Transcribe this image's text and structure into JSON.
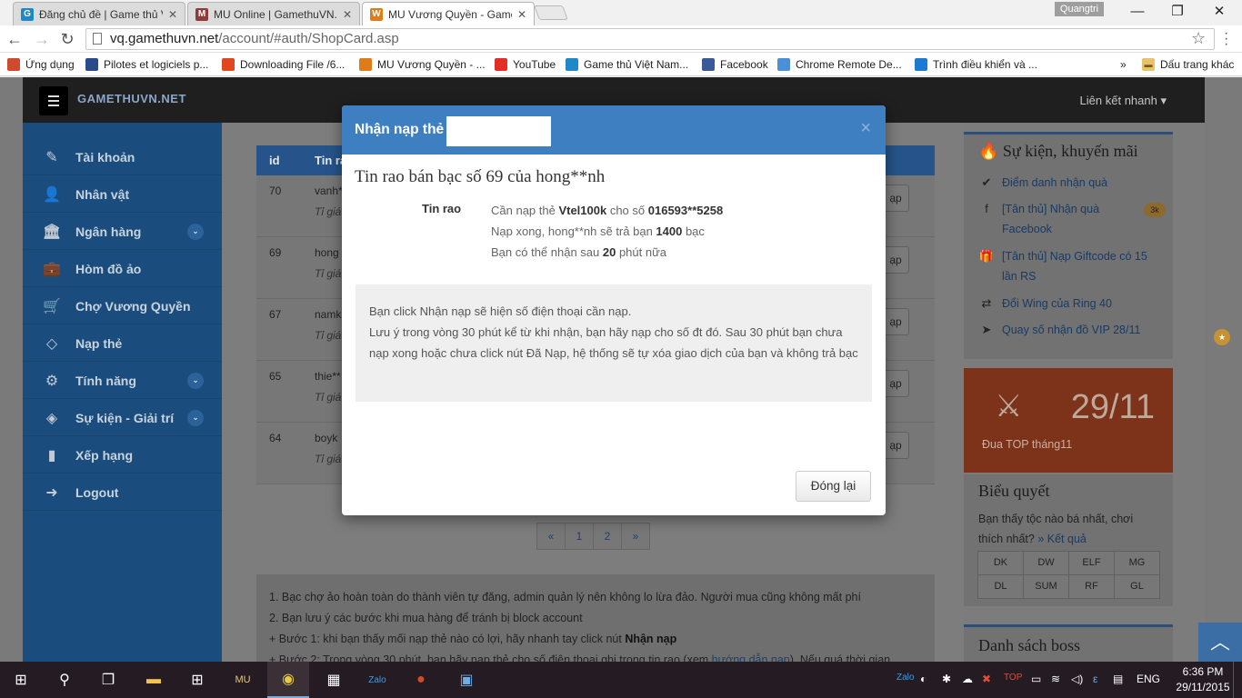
{
  "browser": {
    "tabs": [
      {
        "title": "Đăng chủ đề | Game thủ V",
        "icon": "G",
        "color": "#1e88c9",
        "active": false
      },
      {
        "title": "MU Online | GamethuVN.n",
        "icon": "M",
        "color": "#8f3b3b",
        "active": false
      },
      {
        "title": "MU Vương Quyền - Game",
        "icon": "W",
        "color": "#e07b1a",
        "active": true
      }
    ],
    "user": "Quangtri",
    "window_controls": [
      "—",
      "❐",
      "✕"
    ],
    "url_host": "vq.gamethuvn.net",
    "url_path": "/account/#auth/ShopCard.asp",
    "bookmarks": [
      {
        "label": "Ứng dụng",
        "icon": "apps-icon",
        "color": "#d04a2f"
      },
      {
        "label": "Pilotes et logiciels p...",
        "icon": "hp-icon",
        "color": "#2a4a8a"
      },
      {
        "label": "Downloading File /6...",
        "icon": "ball-icon",
        "color": "#e0461f"
      },
      {
        "label": "MU Vương Quyền - ...",
        "icon": "mu-icon",
        "color": "#e07b1a"
      },
      {
        "label": "YouTube",
        "icon": "youtube-icon",
        "color": "#e52d27"
      },
      {
        "label": "Game thủ Việt Nam...",
        "icon": "gamethu-icon",
        "color": "#1e88c9"
      },
      {
        "label": "Facebook",
        "icon": "facebook-icon",
        "color": "#3b5998"
      },
      {
        "label": "Chrome Remote De...",
        "icon": "remote-icon",
        "color": "#4a8fd8"
      },
      {
        "label": "Trình điều khiển và ...",
        "icon": "hp2-icon",
        "color": "#1a7bd0"
      }
    ],
    "overflow": "»",
    "other_bookmarks": "Dấu trang khác"
  },
  "site": {
    "logo": "GAMETHUVN.NET",
    "quick_link": "Liên kết nhanh",
    "sidebar": [
      {
        "label": "Tài khoản",
        "icon": "edit-icon",
        "glyph": "✎",
        "badge": ""
      },
      {
        "label": "Nhân vật",
        "icon": "user-icon",
        "glyph": "👤",
        "badge": ""
      },
      {
        "label": "Ngân hàng",
        "icon": "bank-icon",
        "glyph": "🏛",
        "badge": "⌄"
      },
      {
        "label": "Hòm đồ ảo",
        "icon": "briefcase-icon",
        "glyph": "💼",
        "badge": ""
      },
      {
        "label": "Chợ Vương Quyền",
        "icon": "cart-icon",
        "glyph": "🛒",
        "badge": ""
      },
      {
        "label": "Nạp thẻ",
        "icon": "diamond-icon",
        "glyph": "◇",
        "badge": "★"
      },
      {
        "label": "Tính năng",
        "icon": "cogs-icon",
        "glyph": "⚙",
        "badge": "⌄"
      },
      {
        "label": "Sự kiện - Giải trí",
        "icon": "code-icon",
        "glyph": "◈",
        "badge": "⌄"
      },
      {
        "label": "Xếp hạng",
        "icon": "bar-chart-icon",
        "glyph": "▮",
        "badge": ""
      },
      {
        "label": "Logout",
        "icon": "sign-out-icon",
        "glyph": "➜",
        "badge": ""
      }
    ],
    "table": {
      "columns": [
        "id",
        "Tin rao"
      ],
      "rows": [
        {
          "id": "70",
          "name": "vanh**",
          "sub": "Tỉ giá",
          "action": "ạp"
        },
        {
          "id": "69",
          "name": "hong",
          "sub": "Tỉ giá",
          "action": "ạp"
        },
        {
          "id": "67",
          "name": "namk",
          "sub": "Tỉ giá",
          "action": "ạp"
        },
        {
          "id": "65",
          "name": "thie**",
          "sub": "Tỉ giá",
          "action": "ạp"
        },
        {
          "id": "64",
          "name": "boyk",
          "sub": "Tỉ giá",
          "action": "ạp"
        }
      ]
    },
    "pagination": [
      "«",
      "1",
      "2",
      "»"
    ],
    "notes": {
      "line1": "1. Bạc chợ ảo hoàn toàn do thành viên tự đăng, admin quản lý nên không lo lừa đảo. Người mua cũng không mất phí",
      "line2": "2. Bạn lưu ý các bước khi mua hàng để tránh bị block account",
      "line3_prefix": "+ Bước 1: khi bạn thấy mối nạp thẻ nào có lợi, hãy nhanh tay click nút ",
      "line3_bold": "Nhận nạp",
      "line4_prefix": "+ Bước 2: Trong vòng 30 phút, bạn hãy nạp thẻ cho số điện thoại ghi trong tin rao (xem ",
      "line4_link": "hướng dẫn nạp",
      "line4_suffix": "). Nếu quá thời gian"
    },
    "events": {
      "title": "Sự kiện, khuyến mãi",
      "items": [
        {
          "label": "Điểm danh nhận quà",
          "icon": "check-circle-icon",
          "glyph": "✔",
          "badge": ""
        },
        {
          "label": "[Tân thủ] Nhận quà Facebook",
          "icon": "facebook-f-icon",
          "glyph": "f",
          "badge": "3k"
        },
        {
          "label": "[Tân thủ] Nạp Giftcode có 15 lần RS",
          "icon": "gift-icon",
          "glyph": "🎁",
          "badge": ""
        },
        {
          "label": "Đổi Wing của Ring 40",
          "icon": "exchange-icon",
          "glyph": "⇄",
          "badge": ""
        },
        {
          "label": "Quay số nhận đồ VIP 28/11",
          "icon": "location-arrow-icon",
          "glyph": "➤",
          "badge": ""
        }
      ]
    },
    "top_month": {
      "date": "29/11",
      "label": "Đua TOP tháng11"
    },
    "vote": {
      "title": "Biểu quyết",
      "question": "Bạn thấy tộc nào bá nhất, chơi thích nhất?",
      "result_link": "» Kết quả",
      "options": [
        "DK",
        "DW",
        "ELF",
        "MG",
        "DL",
        "SUM",
        "RF",
        "GL"
      ]
    },
    "bosses_title": "Danh sách boss"
  },
  "modal": {
    "title": "Nhận nạp thẻ",
    "heading": "Tin rao bán bạc số 69 của hong**nh",
    "tinrao_label": "Tin rao",
    "line1_prefix": "Cần nạp thẻ ",
    "card": "Vtel100k",
    "line1_mid": " cho số ",
    "phone": "016593**5258",
    "line2_prefix": "Nạp xong, hong**nh sẽ trả bạn ",
    "amount": "1400",
    "line2_suffix": " bạc",
    "line3_prefix": "Bạn có thể nhận sau ",
    "minutes": "20",
    "line3_suffix": " phút nữa",
    "notice1": "Bạn click Nhận nạp sẽ hiện số điện thoại cần nạp.",
    "notice2": "Lưu ý trong vòng 30 phút kể từ khi nhận, bạn hãy nạp cho số đt đó. Sau 30 phút bạn chưa nạp xong hoặc chưa click nút Đã Nạp, hệ thống sẽ tự xóa giao dịch của bạn và không trả bạc",
    "close_x": "×",
    "close_button": "Đóng lại"
  },
  "taskbar": {
    "language": "ENG",
    "time": "6:36 PM",
    "date": "29/11/2015"
  }
}
